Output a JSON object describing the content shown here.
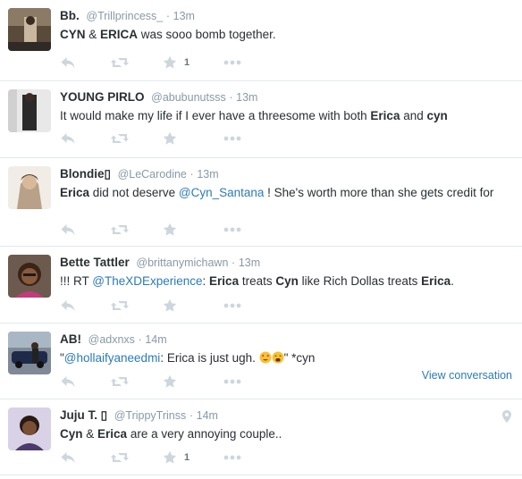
{
  "tweets": [
    {
      "fullname": "Bb.",
      "handle": "@Trillprincess_",
      "separator": "·",
      "time": "13m",
      "text": {
        "b1": "CYN",
        "t1": " & ",
        "b2": "ERICA",
        "t2": " was sooo bomb together."
      },
      "fav_count": "1"
    },
    {
      "fullname": "YOUNG PIRLO",
      "handle": "@abubunutsss",
      "separator": "·",
      "time": "13m",
      "text": {
        "t1": "It would make my life if I ever have a threesome with both ",
        "b1": "Erica",
        "t2": " and ",
        "b2": "cyn"
      },
      "fav_count": ""
    },
    {
      "fullname": "Blondie",
      "name_glyph": "▯",
      "handle": "@LeCarodine",
      "separator": "·",
      "time": "13m",
      "text": {
        "b1": "Erica",
        "t1": " did not deserve ",
        "m1": "@Cyn_Santana",
        "t2": " ! She's worth more than she gets credit for"
      },
      "fav_count": ""
    },
    {
      "fullname": "Bette Tattler",
      "handle": "@brittanymichawn",
      "separator": "·",
      "time": "13m",
      "text": {
        "t1": "!!! RT ",
        "m1": "@TheXDExperience",
        "t2": ": ",
        "b1": "Erica",
        "t3": " treats ",
        "b2": "Cyn",
        "t4": " like Rich Dollas treats ",
        "b3": "Erica",
        "t5": "."
      },
      "fav_count": ""
    },
    {
      "fullname": "AB!",
      "handle": "@adxnxs",
      "separator": "·",
      "time": "14m",
      "text": {
        "t1": "\"",
        "m1": "@hollaifyaneedmi",
        "t2": ": Erica is just ugh. ",
        "t3": "\" *cyn"
      },
      "emojis": [
        "heart-eyes-emoji",
        "weary-emoji"
      ],
      "view_conversation": "View conversation",
      "fav_count": ""
    },
    {
      "fullname": "Juju T.",
      "name_glyph": "▯",
      "handle": "@TrippyTrinss",
      "separator": "·",
      "time": "14m",
      "text": {
        "b1": "Cyn",
        "t1": " & ",
        "b2": "Erica",
        "t2": " are a very annoying couple.."
      },
      "fav_count": "1"
    }
  ],
  "icons": {
    "reply": "reply-icon",
    "retweet": "retweet-icon",
    "favorite": "star-icon",
    "more": "more-icon",
    "geo": "location-pin-icon"
  },
  "colors": {
    "link": "#2b7bb9",
    "muted": "#8899a6",
    "icon": "#ccd6dd",
    "divider": "#e1e8ed"
  }
}
